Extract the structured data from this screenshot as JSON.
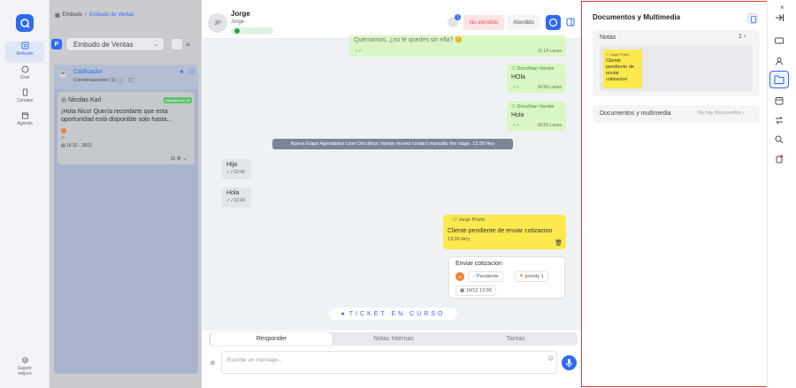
{
  "nav": {
    "items": [
      {
        "label": "Embudo",
        "icon": "funnel-icon",
        "active": true
      },
      {
        "label": "Chat",
        "icon": "chat-icon",
        "active": false
      },
      {
        "label": "Canales",
        "icon": "phone-icon",
        "active": false
      },
      {
        "label": "Agenda",
        "icon": "calendar-icon",
        "active": false
      }
    ],
    "suggest": {
      "line1": "Sugerir",
      "line2": "mejora"
    }
  },
  "breadcrumb": {
    "root": "Embudo",
    "current": "Embudo de Ventas"
  },
  "pipeline": {
    "badge": "P",
    "name": "Embudo de Ventas"
  },
  "column": {
    "title": "Calificador",
    "subtitle": "Conversaciones (1)"
  },
  "card": {
    "name": "Nicolas Karl",
    "tag": "Atendido por IA",
    "message": "¡Hola Nico! Quería recordarte que esta oportunidad está disponible solo hasta...",
    "date": "16:32 - 28/11"
  },
  "chat": {
    "contact": {
      "initials": "JP",
      "name": "Jorge",
      "sub": "Jorge"
    },
    "notif_count": "1",
    "status_unattended": "No atendido",
    "status_attended": "Atendido",
    "messages": [
      {
        "kind": "out",
        "text": "Quemamos, ¿no te quedes sin ella? 😊",
        "time": "11:14 Lunes"
      },
      {
        "kind": "out",
        "sender": "Docuthan Vambe",
        "text": "HOla",
        "time": "16:56 Lunes"
      },
      {
        "kind": "out",
        "sender": "Docuthan Vambe",
        "text": "Hola",
        "time": "16:56 Lunes"
      },
      {
        "kind": "in",
        "text": "Hija",
        "time": "12:42"
      },
      {
        "kind": "in",
        "text": "Hola",
        "time": "12:43"
      }
    ],
    "system": "Nueva Etapa Agendados  User Docuthan Vambe moved contact manually the stage.  12:39 Hoy",
    "note": {
      "author": "Jorge Prieto",
      "text": "Cliente pendiente de enviar cotizacion",
      "time": "13:26 Hoy"
    },
    "task": {
      "title": "Enviar cotizacion",
      "assignee": "JP",
      "status": "Pendiente",
      "priority": "priority 1",
      "date": "10/12 12:00"
    },
    "ticket": "TICKET EN CURSO",
    "tabs": [
      "Responder",
      "Notas Internas",
      "Tareas"
    ],
    "input_placeholder": "Escribe un mensaje..."
  },
  "panel": {
    "title": "Documentos y Multimedia",
    "notes_label": "Notas",
    "notes_count": "1",
    "sticky": {
      "author": "Jorge Prieto",
      "text": "Cliente pendiente de enviar cotizacion"
    },
    "docs_label": "Documentos y multimedia",
    "docs_empty": "No hay documentos"
  },
  "colors": {
    "accent": "#2f6bf0",
    "out_bubble": "#d9f7c5",
    "note": "#fde94d",
    "highlight": "#e53935"
  }
}
